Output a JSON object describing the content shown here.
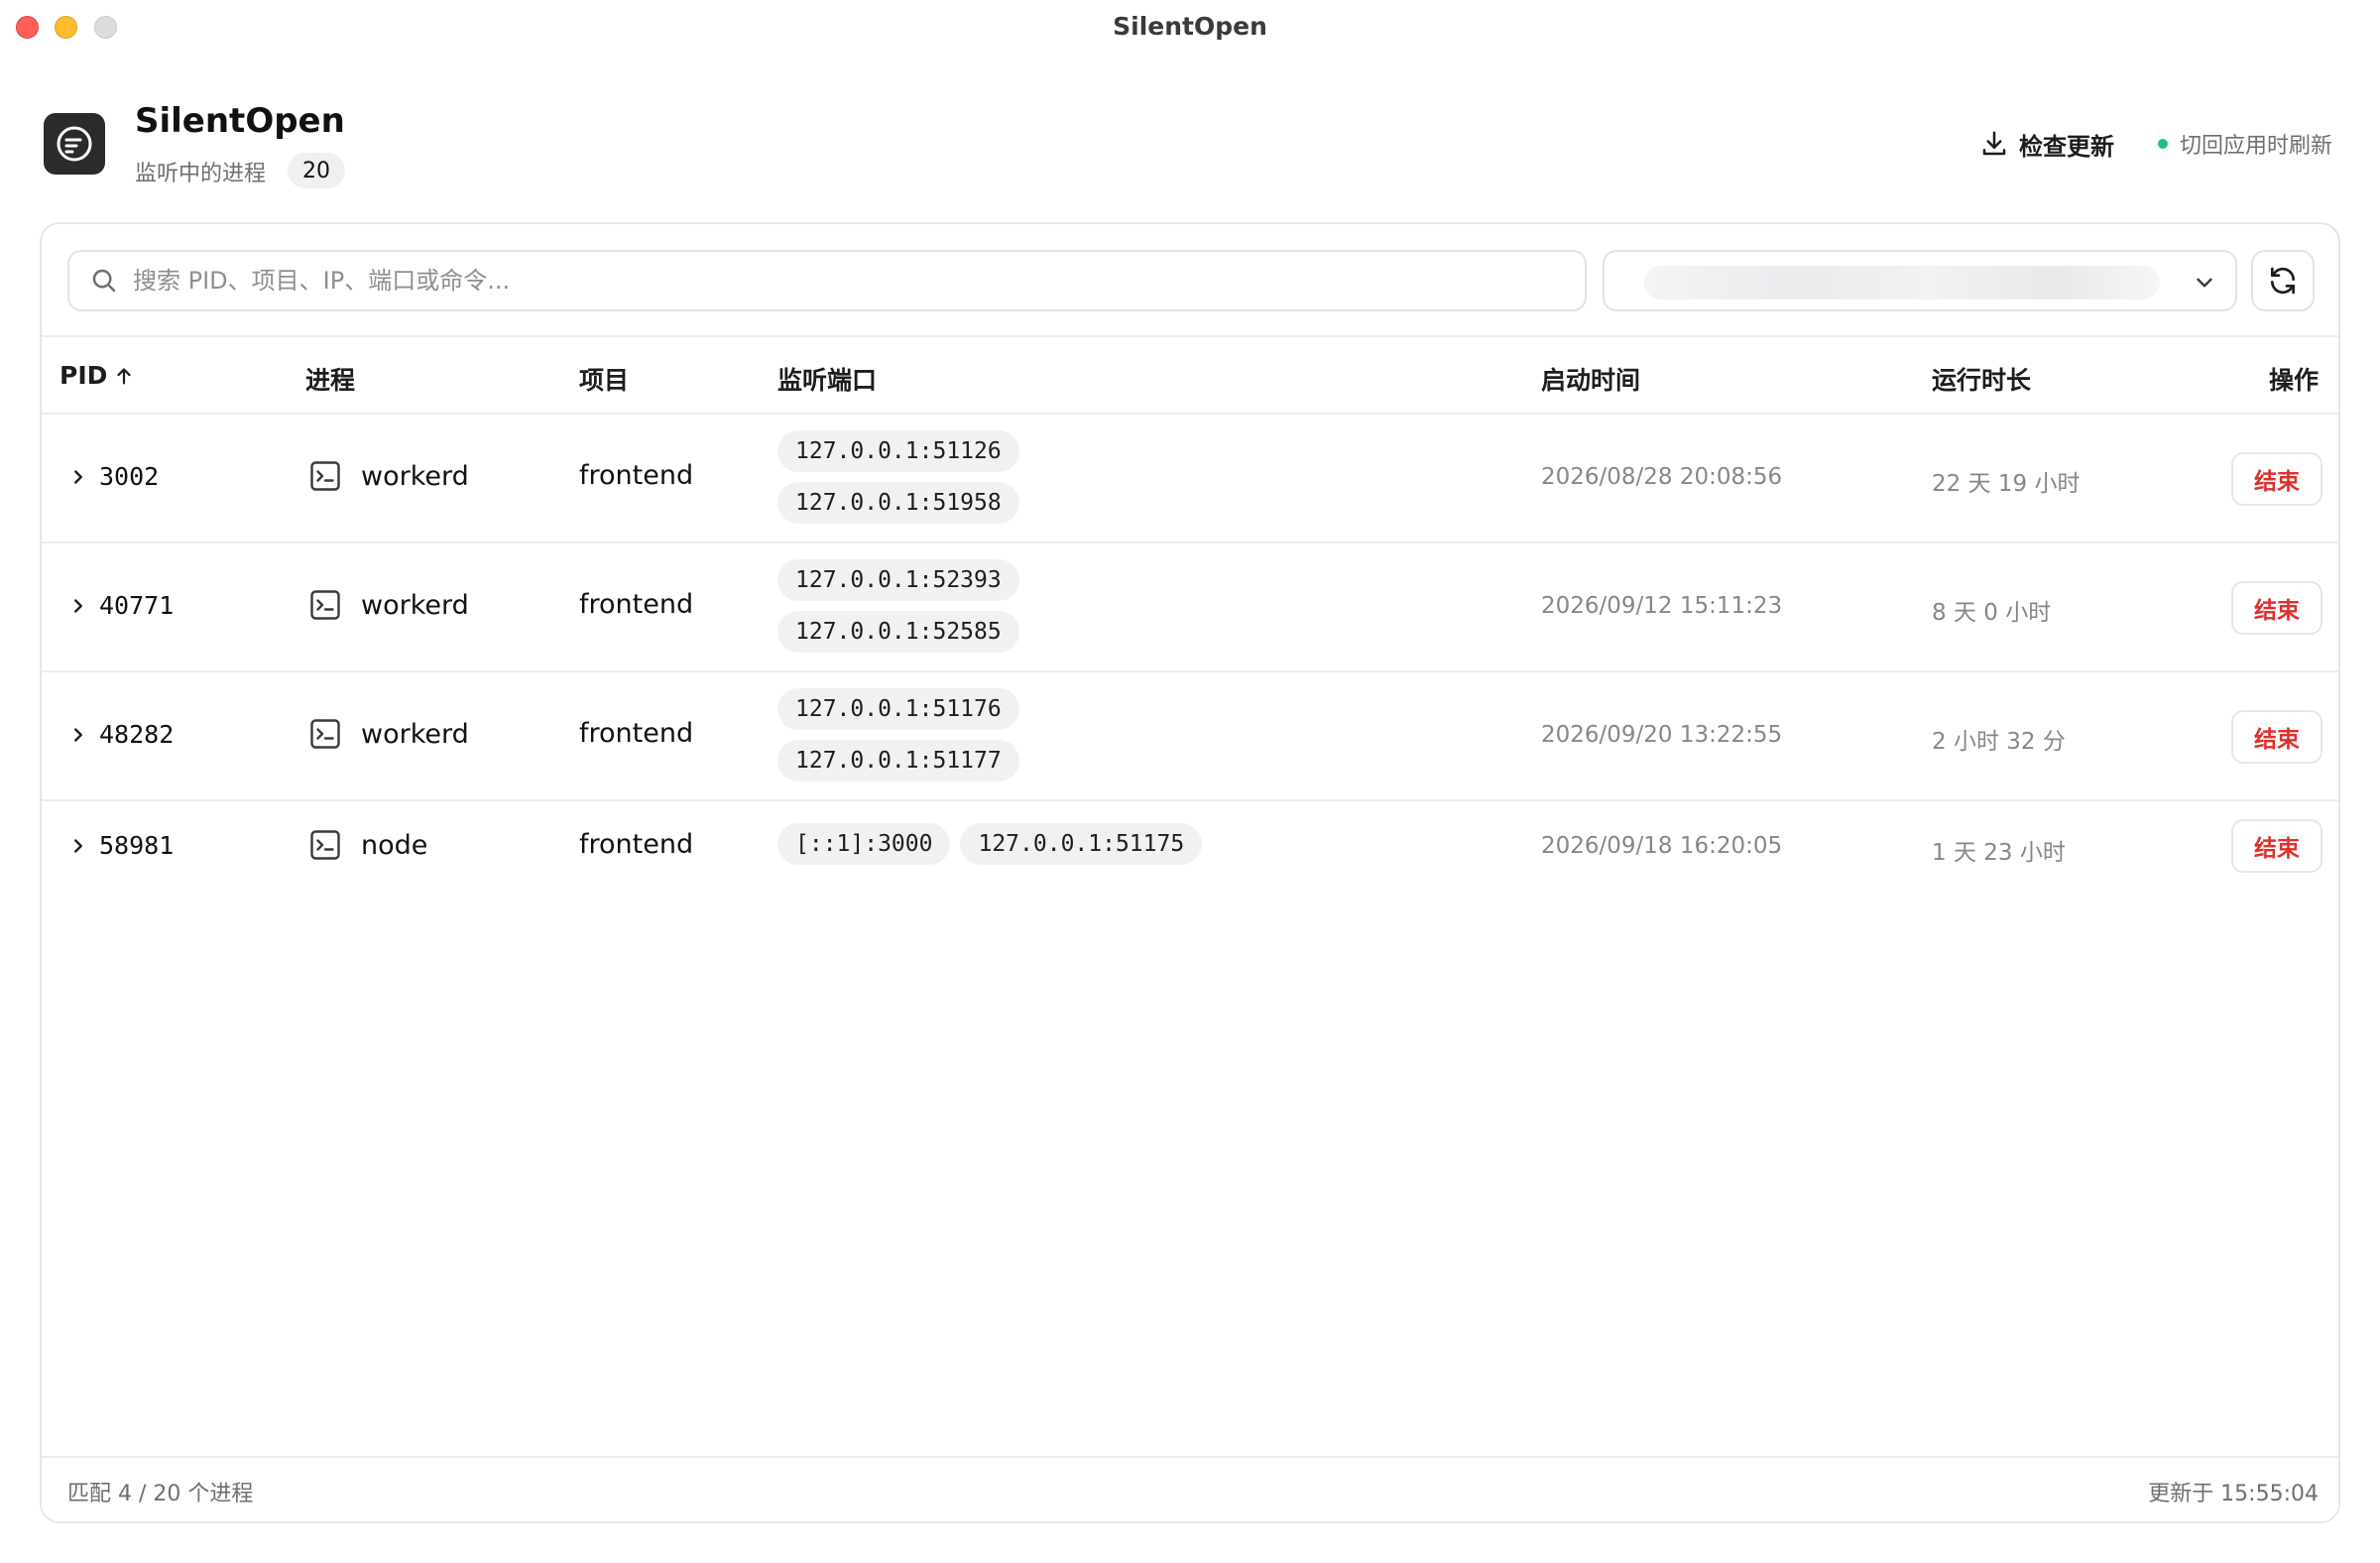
{
  "window": {
    "title": "SilentOpen"
  },
  "header": {
    "app_name": "SilentOpen",
    "sub_label": "监听中的进程",
    "process_count": "20",
    "check_update_label": "检查更新",
    "refresh_note": "切回应用时刷新",
    "accent_green": "#1ec27a"
  },
  "search": {
    "placeholder": "搜索 PID、项目、IP、端口或命令...",
    "value": ""
  },
  "table": {
    "columns": {
      "pid": "PID",
      "process": "进程",
      "project": "项目",
      "ports": "监听端口",
      "start_time": "启动时间",
      "duration": "运行时长",
      "action": "操作"
    },
    "sort": {
      "column": "pid",
      "direction": "ascending"
    },
    "rows": [
      {
        "pid": "3002",
        "process": "workerd",
        "project": "frontend",
        "ports": [
          "127.0.0.1:51126",
          "127.0.0.1:51958"
        ],
        "start_time": "2026/08/28 20:08:56",
        "duration": "22 天 19 小时",
        "action": "结束"
      },
      {
        "pid": "40771",
        "process": "workerd",
        "project": "frontend",
        "ports": [
          "127.0.0.1:52393",
          "127.0.0.1:52585"
        ],
        "start_time": "2026/09/12 15:11:23",
        "duration": "8 天 0 小时",
        "action": "结束"
      },
      {
        "pid": "48282",
        "process": "workerd",
        "project": "frontend",
        "ports": [
          "127.0.0.1:51176",
          "127.0.0.1:51177"
        ],
        "start_time": "2026/09/20 13:22:55",
        "duration": "2 小时 32 分",
        "action": "结束"
      },
      {
        "pid": "58981",
        "process": "node",
        "project": "frontend",
        "ports": [
          "[::1]:3000",
          "127.0.0.1:51175"
        ],
        "start_time": "2026/09/18 16:20:05",
        "duration": "1 天 23 小时",
        "action": "结束"
      }
    ]
  },
  "footer": {
    "match_summary": "匹配 4 / 20 个进程",
    "updated_at": "更新于 15:55:04"
  },
  "colors": {
    "danger": "#e0302c",
    "border": "#e6e6e8"
  }
}
